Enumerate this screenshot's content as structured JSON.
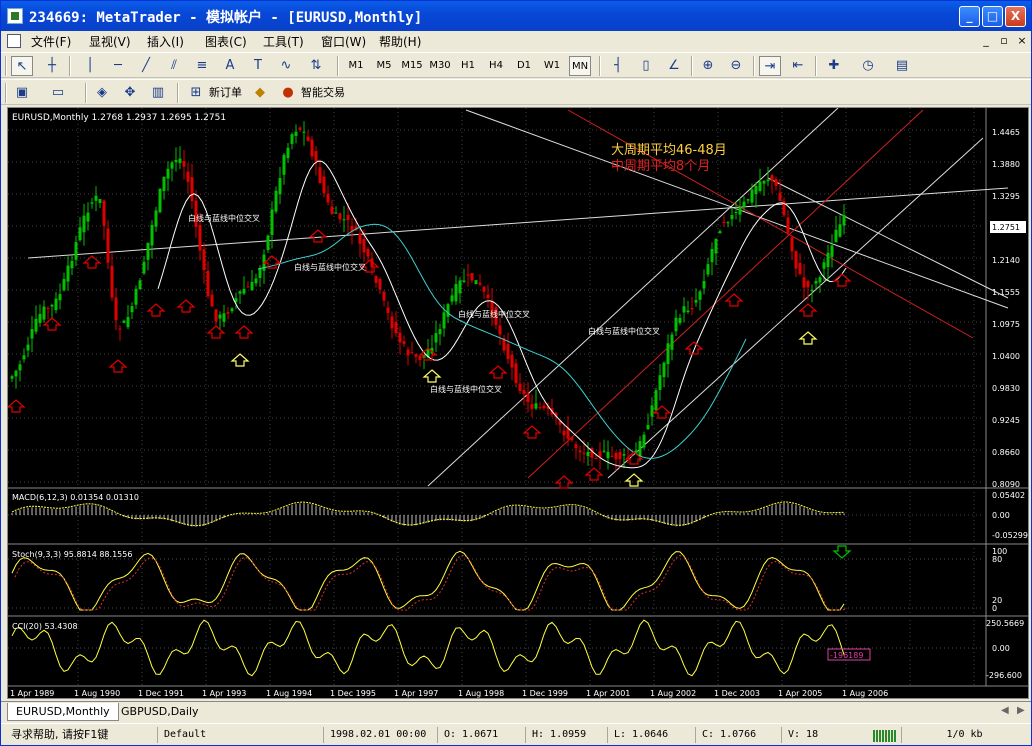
{
  "window": {
    "title": "234669: MetaTrader - 模拟帐户 - [EURUSD,Monthly]",
    "minimize": "_",
    "maximize": "□",
    "close": "X"
  },
  "menu": {
    "items": [
      "文件(F)",
      "显视(V)",
      "插入(I)",
      "图表(C)",
      "工具(T)",
      "窗口(W)",
      "帮助(H)"
    ],
    "mdi": [
      "_",
      "▫",
      "×"
    ]
  },
  "toolbar1": {
    "timeframes": [
      "M1",
      "M5",
      "M15",
      "M30",
      "H1",
      "H4",
      "D1",
      "W1",
      "MN"
    ],
    "active_timeframe": "MN"
  },
  "toolbar2": {
    "new_order": "新订单",
    "expert": "智能交易"
  },
  "chart": {
    "header": "EURUSD,Monthly  1.2768 1.2937 1.2695 1.2751",
    "current_price": "1.2751",
    "price_ticks": [
      "1.4465",
      "1.3880",
      "1.3295",
      "1.2140",
      "1.1555",
      "1.0975",
      "1.0400",
      "0.9830",
      "0.9245",
      "0.8660",
      "0.8090"
    ],
    "annotation_big": "大周期平均46-48月",
    "annotation_mid": "中周期平均8个月",
    "cross_label": "白线与蓝线中位交叉",
    "macd_label": "MACD(6,12,3) 0.01354 0.01310",
    "macd_ticks": [
      "0.05402",
      "0.00",
      "-0.05299"
    ],
    "stoch_label": "Stoch(9,3,3) 95.8814 88.1556",
    "stoch_ticks": [
      "100",
      "80",
      "20",
      "0"
    ],
    "cci_label": "CCI(20) 53.4308",
    "cci_ticks": [
      "250.5669",
      "0.00",
      "-296.600"
    ],
    "cci_box": "-196189",
    "time_labels": [
      "1 Apr 1989",
      "1 Aug 1990",
      "1 Dec 1991",
      "1 Apr 1993",
      "1 Aug 1994",
      "1 Dec 1995",
      "1 Apr 1997",
      "1 Aug 1998",
      "1 Dec 1999",
      "1 Apr 2001",
      "1 Aug 2002",
      "1 Dec 2003",
      "1 Apr 2005",
      "1 Aug 2006"
    ],
    "colors": {
      "bull": "#00c000",
      "bear": "#e00000",
      "ma_white": "#ffffff",
      "ma_cyan": "#40d0d0",
      "osc": "#ffff40",
      "arrow_red": "#e00000",
      "arrow_yellow": "#ffff60"
    }
  },
  "tabs": [
    "EURUSD,Monthly",
    "GBPUSD,Daily"
  ],
  "status": {
    "help": "寻求帮助, 请按F1键",
    "profile": "Default",
    "datetime": "1998.02.01 00:00",
    "open": "O: 1.0671",
    "high": "H: 1.0959",
    "low": "L: 1.0646",
    "close": "C: 1.0766",
    "volume": "V: 18",
    "traffic": "1/0 kb"
  }
}
